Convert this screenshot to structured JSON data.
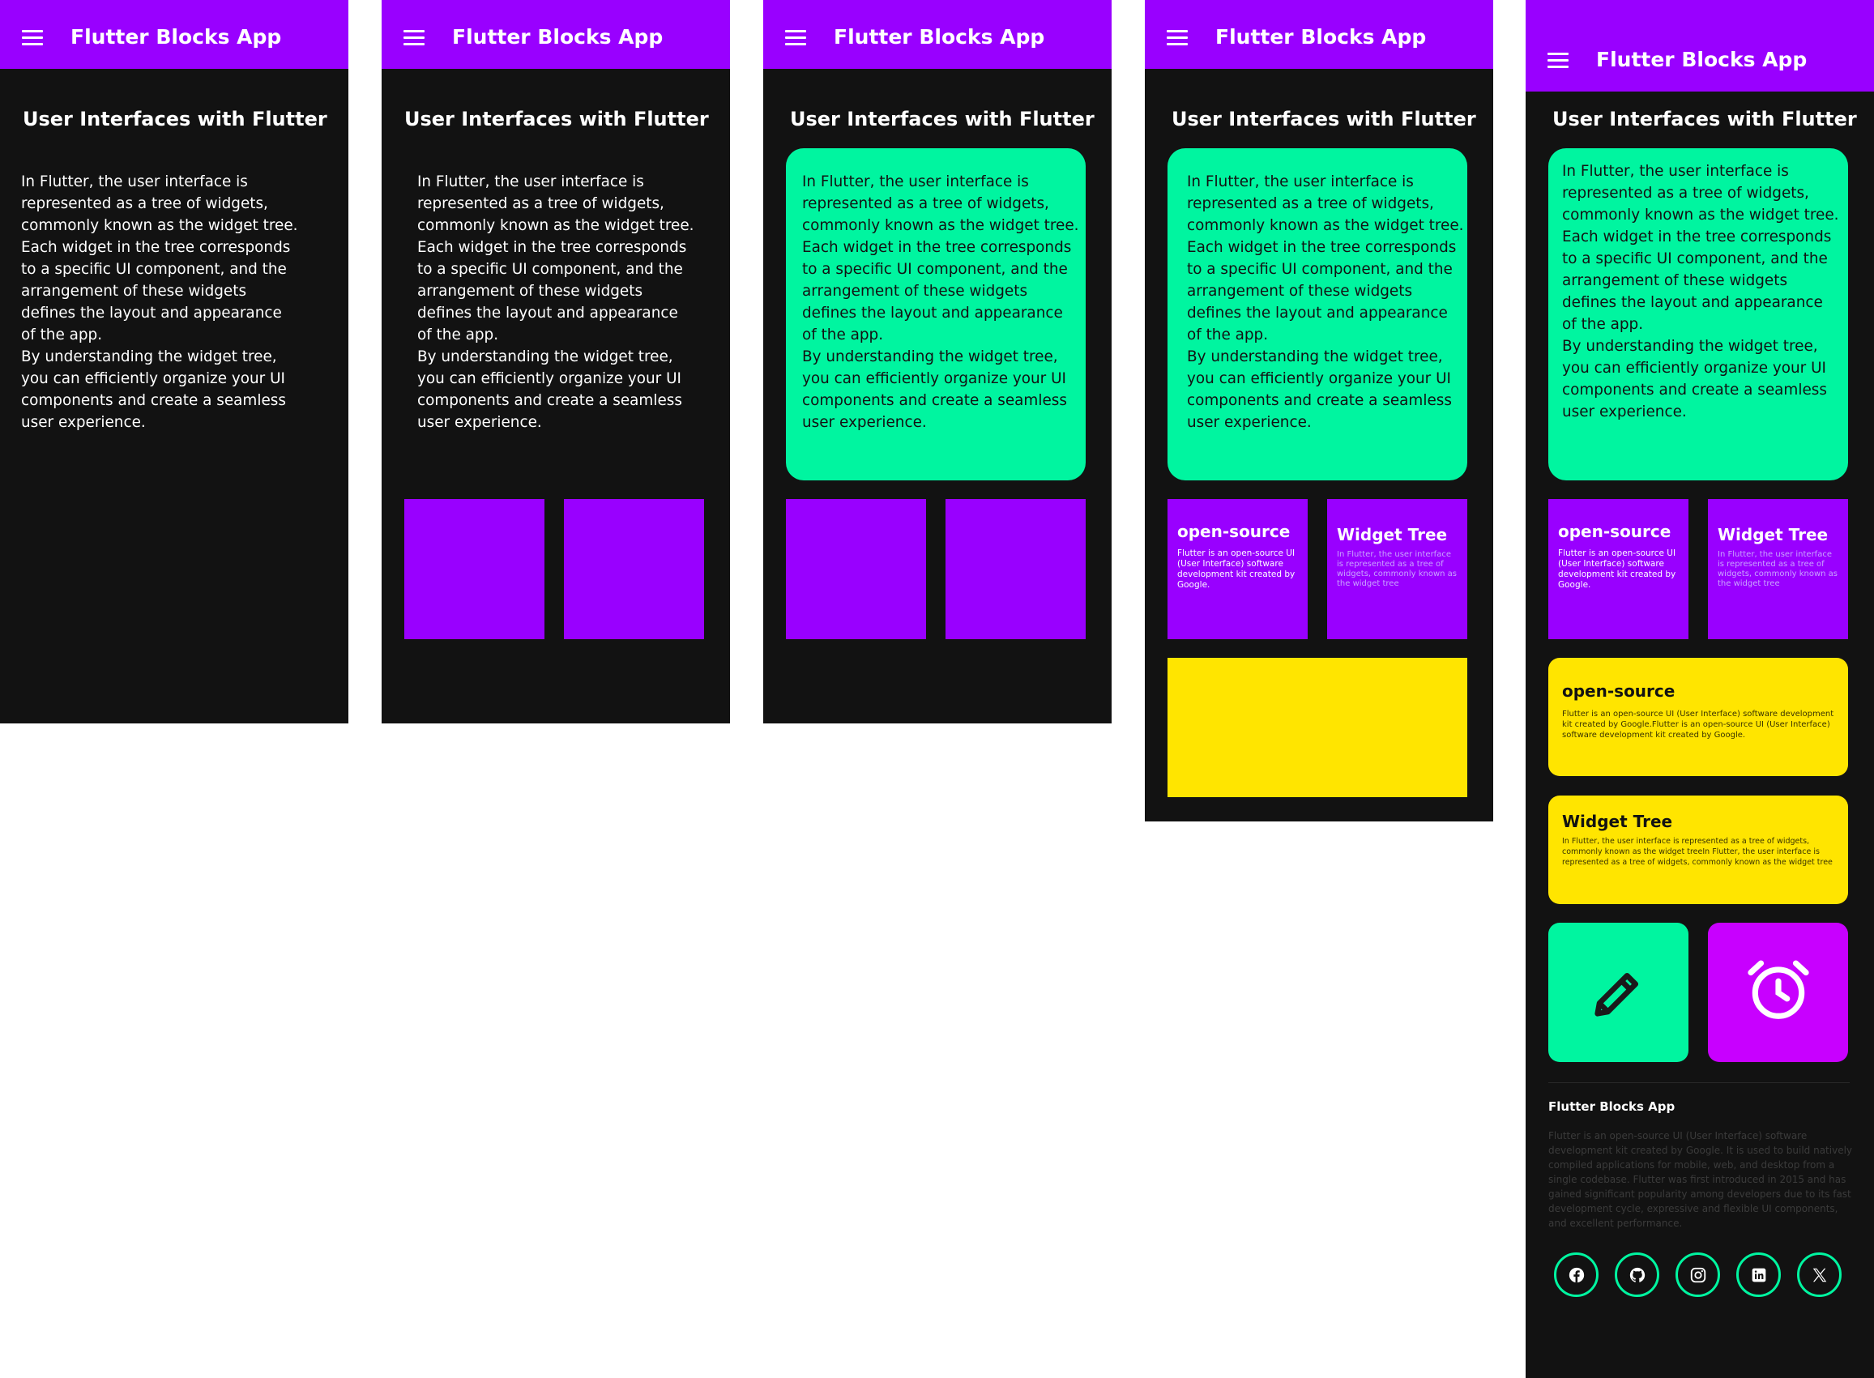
{
  "app_title": "Flutter Blocks App",
  "section_title": "User Interfaces with Flutter",
  "intro_text": "In Flutter, the user interface is\nrepresented as a tree of widgets,\ncommonly known as the widget tree.\nEach widget in the tree corresponds\nto a specific UI component, and the\narrangement of these widgets\ndefines the layout and appearance\nof the app.\nBy understanding the widget tree,\nyou can efficiently organize your UI\ncomponents and create a seamless\nuser experience.",
  "tiles": {
    "open_source": {
      "title": "open-source",
      "text": "Flutter is an open-source UI (User Interface) software development kit created by Google."
    },
    "widget_tree": {
      "title": "Widget Tree",
      "text": "In Flutter, the user interface is represented as a tree of widgets, commonly known as the widget tree"
    }
  },
  "cards": {
    "open_source": {
      "title": "open-source",
      "text": "Flutter is an open-source UI (User Interface) software development kit created by Google.Flutter is an open-source UI (User Interface) software development kit created by Google."
    },
    "widget_tree": {
      "title": "Widget Tree",
      "text": "In Flutter, the user interface is represented as a tree of widgets, commonly known as the widget treeIn Flutter, the user interface is represented as a tree of widgets, commonly known as the widget tree"
    }
  },
  "footer": {
    "title": "Flutter Blocks App",
    "text": "Flutter is an open-source UI (User Interface) software development kit created by Google. It is used to build natively compiled applications for mobile, web, and desktop from a single codebase. Flutter was first introduced in 2015 and has gained significant popularity among developers due to its fast development cycle, expressive and flexible UI components, and excellent performance."
  },
  "icons": {
    "menu": "menu-icon",
    "edit": "pencil-icon",
    "alarm": "alarm-clock-icon",
    "social": [
      "facebook-icon",
      "github-icon",
      "instagram-icon",
      "linkedin-icon",
      "x-twitter-icon"
    ]
  },
  "colors": {
    "appbar": "#9900ff",
    "background": "#121212",
    "green": "#00f5a0",
    "purple": "#9900ff",
    "magenta": "#c800ff",
    "yellow": "#ffe500"
  }
}
